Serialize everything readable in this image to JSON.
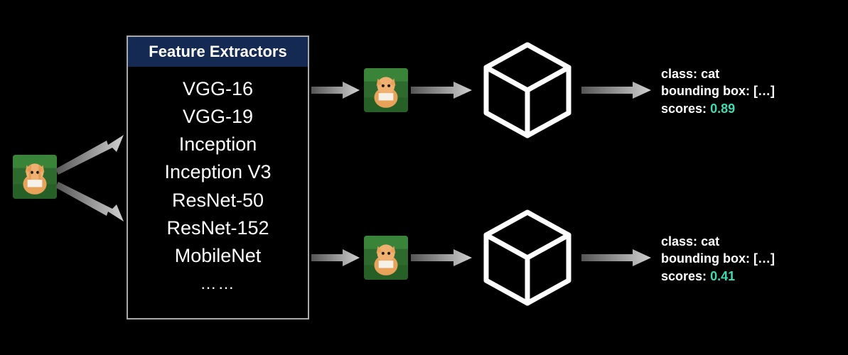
{
  "input": {
    "image_label": "cat"
  },
  "feature_extractors": {
    "header": "Feature Extractors",
    "items": [
      "VGG-16",
      "VGG-19",
      "Inception",
      "Inception V3",
      "ResNet-50",
      "ResNet-152",
      "MobileNet"
    ],
    "more": "……"
  },
  "branches": [
    {
      "image_label": "cat",
      "output": {
        "class_label": "class:",
        "class_value": "cat",
        "bbox_label": "bounding box:",
        "bbox_value": "[…]",
        "scores_label": "scores:",
        "scores_value": "0.89"
      }
    },
    {
      "image_label": "cat",
      "output": {
        "class_label": "class:",
        "class_value": "cat",
        "bbox_label": "bounding box:",
        "bbox_value": "[…]",
        "scores_label": "scores:",
        "scores_value": "0.41"
      }
    }
  ]
}
